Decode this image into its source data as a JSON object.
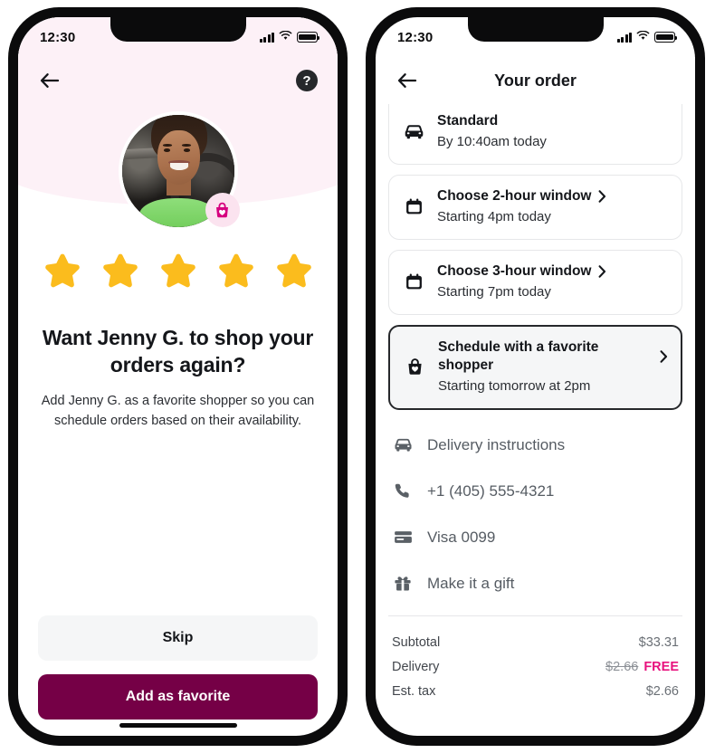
{
  "theme": {
    "pink_bg": "#fdf1f7",
    "primary_button": "#750046",
    "star": "#fbbc1d",
    "magenta": "#e8127e",
    "badge_bg": "#fbe3ef",
    "card_selected_bg": "#f5f6f7",
    "card_selected_border": "#26282b"
  },
  "left_phone": {
    "status_bar": {
      "time": "12:30",
      "signal_icon": "cellular-bars-icon",
      "wifi_icon": "wifi-icon",
      "battery_icon": "battery-full-icon"
    },
    "nav": {
      "back_icon": "back-arrow-icon",
      "help_icon": "help-question-icon",
      "help_glyph": "?"
    },
    "avatar": {
      "alt": "shopper-photo",
      "badge_icon": "favorite-shopper-bag-heart-icon"
    },
    "rating": {
      "stars": 5,
      "star_icon": "star-filled-icon"
    },
    "headline": "Want Jenny G. to shop your orders again?",
    "subtext": "Add Jenny G. as a favorite shopper so you can schedule orders based on their availability.",
    "actions": {
      "skip_label": "Skip",
      "primary_label": "Add as favorite"
    }
  },
  "right_phone": {
    "status_bar": {
      "time": "12:30",
      "signal_icon": "cellular-bars-icon",
      "wifi_icon": "wifi-icon",
      "battery_icon": "battery-full-icon"
    },
    "nav": {
      "back_icon": "back-arrow-icon",
      "title": "Your order"
    },
    "delivery_options": [
      {
        "icon": "car-delivery-icon",
        "title": "Standard",
        "subtitle": "By 10:40am today",
        "has_chevron": false,
        "selected": false,
        "clipped": true
      },
      {
        "icon": "calendar-icon",
        "title": "Choose 2-hour window",
        "subtitle": "Starting 4pm today",
        "has_chevron": true,
        "selected": false,
        "clipped": false
      },
      {
        "icon": "calendar-icon",
        "title": "Choose 3-hour window",
        "subtitle": "Starting 7pm today",
        "has_chevron": true,
        "selected": false,
        "clipped": false
      },
      {
        "icon": "bag-heart-icon",
        "title": "Schedule with a favorite shopper",
        "subtitle": "Starting tomorrow at 2pm",
        "has_chevron": true,
        "selected": true,
        "clipped": false
      }
    ],
    "info_rows": [
      {
        "icon": "car-delivery-icon",
        "label": "Delivery instructions"
      },
      {
        "icon": "phone-icon",
        "label": "+1 (405) 555-4321"
      },
      {
        "icon": "credit-card-icon",
        "label": "Visa 0099"
      },
      {
        "icon": "gift-icon",
        "label": "Make it a gift"
      }
    ],
    "summary": [
      {
        "label": "Subtotal",
        "value": "$33.31",
        "struck_value": "",
        "free_label": ""
      },
      {
        "label": "Delivery",
        "value": "",
        "struck_value": "$2.66",
        "free_label": "FREE"
      },
      {
        "label": "Est. tax",
        "value": "$2.66",
        "struck_value": "",
        "free_label": ""
      }
    ]
  }
}
